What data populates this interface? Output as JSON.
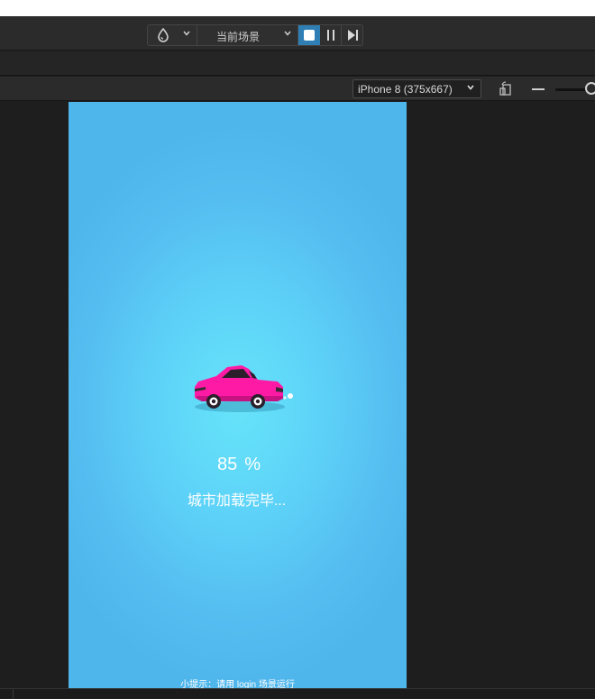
{
  "toolbar": {
    "engine_icon": "drop-icon",
    "scene_select": "当前场景",
    "controls": [
      "stop-icon",
      "pause-icon",
      "step-icon"
    ],
    "accent": "#2f7fb5"
  },
  "preview": {
    "device_select": "iPhone 8 (375x667)",
    "rotate_icon": "rotate-device-icon",
    "zoom_out_icon": "minus-icon"
  },
  "game": {
    "progress_value": "85",
    "progress_unit": "%",
    "status_text": "城市加载完毕...",
    "hint_text": "小提示：请用 login 场景运行",
    "car_color": "#ff1aa6",
    "background_color": "#5ccff7"
  }
}
